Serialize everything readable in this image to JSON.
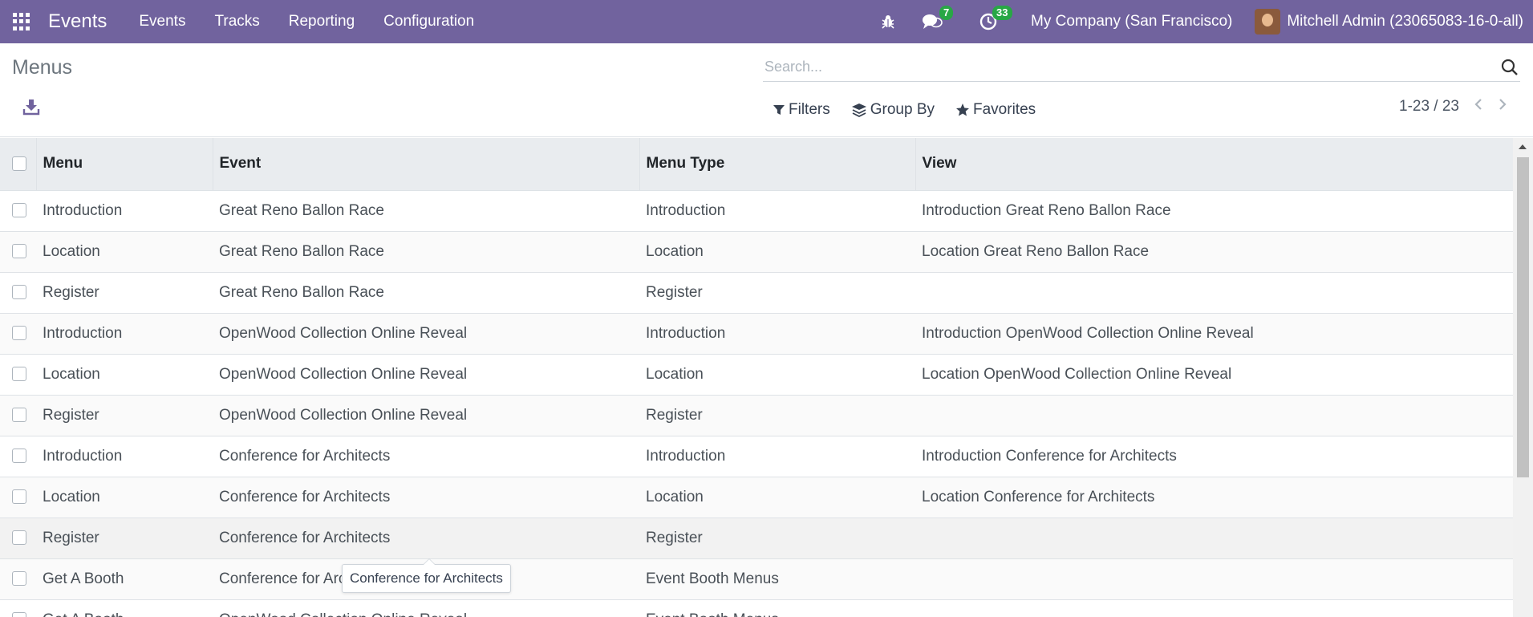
{
  "navbar": {
    "apps_icon": "grid-icon",
    "brand": "Events",
    "menu": [
      "Events",
      "Tracks",
      "Reporting",
      "Configuration"
    ],
    "bug_icon": "bug-icon",
    "messages_icon": "chat-icon",
    "messages_count": "7",
    "activities_icon": "clock-icon",
    "activities_count": "33",
    "company": "My Company (San Francisco)",
    "user": "Mitchell Admin (23065083-16-0-all)"
  },
  "control_panel": {
    "title": "Menus",
    "download_icon": "download-icon",
    "search_placeholder": "Search...",
    "filters_label": "Filters",
    "group_by_label": "Group By",
    "favorites_label": "Favorites",
    "pager": "1-23 / 23"
  },
  "list": {
    "headers": [
      "Menu",
      "Event",
      "Menu Type",
      "View"
    ],
    "rows": [
      {
        "menu": "Introduction",
        "event": "Great Reno Ballon Race",
        "type": "Introduction",
        "view": "Introduction Great Reno Ballon Race"
      },
      {
        "menu": "Location",
        "event": "Great Reno Ballon Race",
        "type": "Location",
        "view": "Location Great Reno Ballon Race"
      },
      {
        "menu": "Register",
        "event": "Great Reno Ballon Race",
        "type": "Register",
        "view": ""
      },
      {
        "menu": "Introduction",
        "event": "OpenWood Collection Online Reveal",
        "type": "Introduction",
        "view": "Introduction OpenWood Collection Online Reveal"
      },
      {
        "menu": "Location",
        "event": "OpenWood Collection Online Reveal",
        "type": "Location",
        "view": "Location OpenWood Collection Online Reveal"
      },
      {
        "menu": "Register",
        "event": "OpenWood Collection Online Reveal",
        "type": "Register",
        "view": ""
      },
      {
        "menu": "Introduction",
        "event": "Conference for Architects",
        "type": "Introduction",
        "view": "Introduction Conference for Architects"
      },
      {
        "menu": "Location",
        "event": "Conference for Architects",
        "type": "Location",
        "view": "Location Conference for Architects"
      },
      {
        "menu": "Register",
        "event": "Conference for Architects",
        "type": "Register",
        "view": ""
      },
      {
        "menu": "Get A Booth",
        "event": "Conference for Architects",
        "type": "Event Booth Menus",
        "view": ""
      },
      {
        "menu": "Get A Booth",
        "event": "OpenWood Collection Online Reveal",
        "type": "Event Booth Menus",
        "view": ""
      }
    ]
  },
  "tooltip": "Conference for Architects",
  "colors": {
    "navbar": "#71639e",
    "badge": "#28a745",
    "header_bg": "#e9ecef"
  }
}
